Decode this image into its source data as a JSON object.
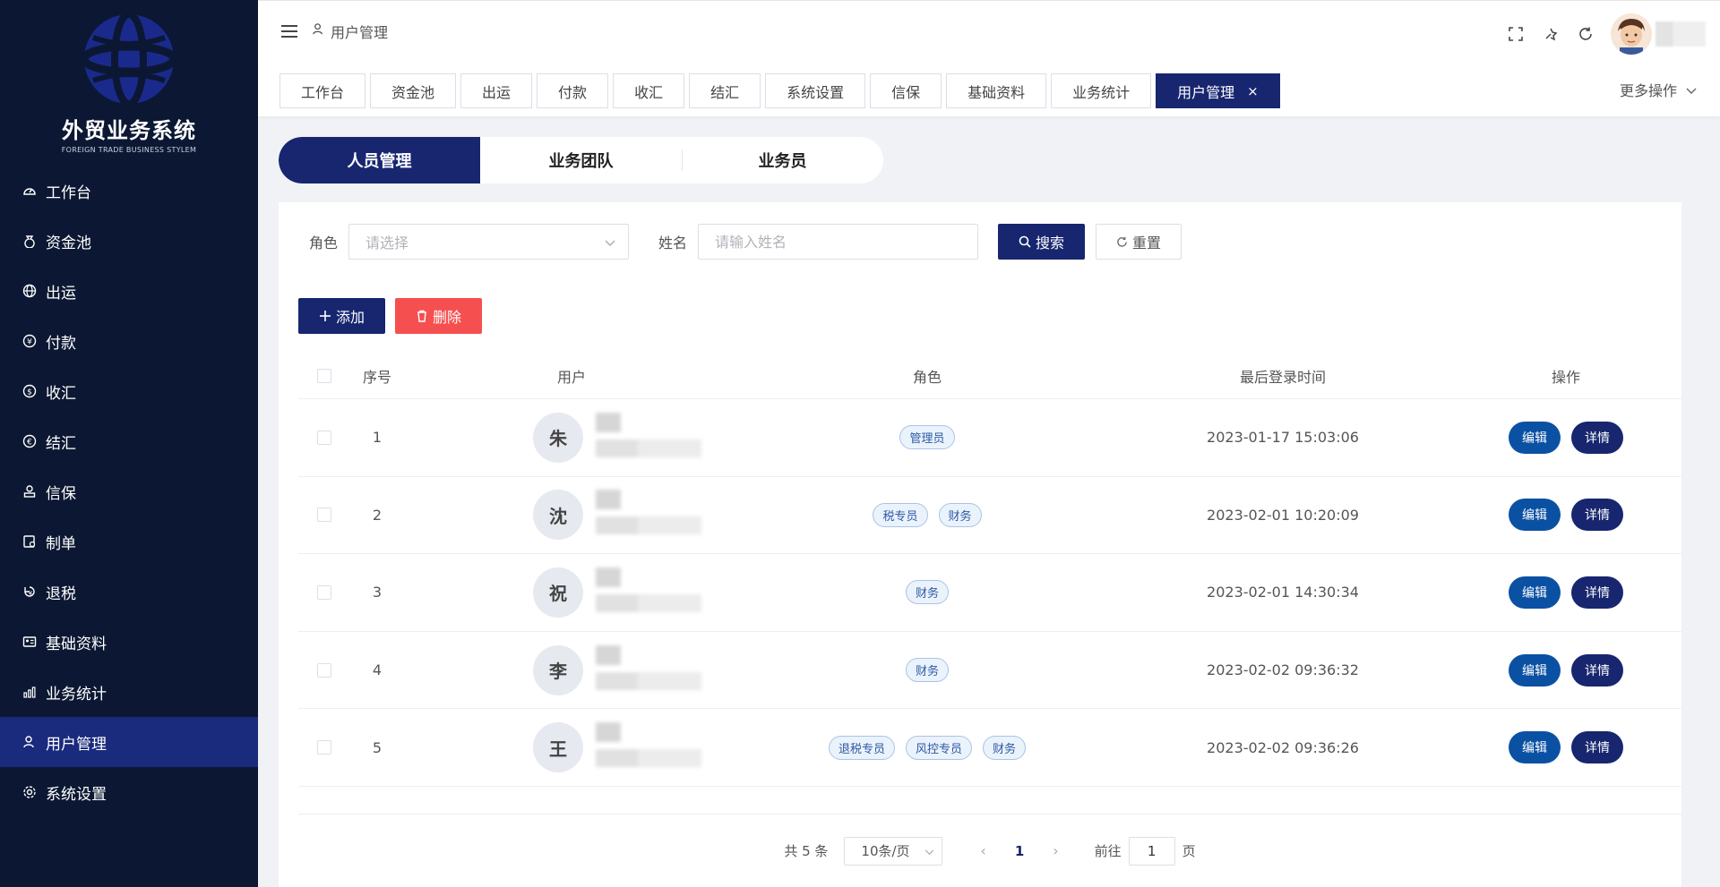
{
  "brand": {
    "title": "外贸业务系统",
    "subtitle": "FOREIGN TRADE BUSINESS STYLEM"
  },
  "sidebar": {
    "items": [
      {
        "label": "工作台",
        "icon": "dashboard-icon",
        "active": false
      },
      {
        "label": "资金池",
        "icon": "money-bag-icon",
        "active": false
      },
      {
        "label": "出运",
        "icon": "globe-icon",
        "active": false
      },
      {
        "label": "付款",
        "icon": "yen-coin-icon",
        "active": false
      },
      {
        "label": "收汇",
        "icon": "exchange-coin-icon",
        "active": false
      },
      {
        "label": "结汇",
        "icon": "settle-coin-icon",
        "active": false
      },
      {
        "label": "信保",
        "icon": "insurance-icon",
        "active": false
      },
      {
        "label": "制单",
        "icon": "document-icon",
        "active": false
      },
      {
        "label": "退税",
        "icon": "tax-refund-icon",
        "active": false
      },
      {
        "label": "基础资料",
        "icon": "id-card-icon",
        "active": false
      },
      {
        "label": "业务统计",
        "icon": "bar-chart-icon",
        "active": false
      },
      {
        "label": "用户管理",
        "icon": "user-icon",
        "active": true
      },
      {
        "label": "系统设置",
        "icon": "gear-icon",
        "active": false
      }
    ]
  },
  "header": {
    "breadcrumb": "用户管理",
    "icons": [
      "fullscreen-icon",
      "theme-icon",
      "refresh-icon"
    ]
  },
  "tabs": {
    "items": [
      {
        "label": "工作台"
      },
      {
        "label": "资金池"
      },
      {
        "label": "出运"
      },
      {
        "label": "付款"
      },
      {
        "label": "收汇"
      },
      {
        "label": "结汇"
      },
      {
        "label": "系统设置"
      },
      {
        "label": "信保"
      },
      {
        "label": "基础资料"
      },
      {
        "label": "业务统计"
      },
      {
        "label": "用户管理",
        "active": true,
        "close": "×"
      }
    ],
    "more": "更多操作"
  },
  "segment": {
    "items": [
      "人员管理",
      "业务团队",
      "业务员"
    ],
    "active_index": 0
  },
  "filters": {
    "role_label": "角色",
    "role_placeholder": "请选择",
    "name_label": "姓名",
    "name_placeholder": "请输入姓名",
    "search": "搜索",
    "reset": "重置"
  },
  "actions": {
    "add": "添加",
    "delete": "删除"
  },
  "table": {
    "headers": {
      "index": "序号",
      "user": "用户",
      "role": "角色",
      "last_login": "最后登录时间",
      "ops": "操作"
    },
    "rows": [
      {
        "index": "1",
        "avatar": "朱",
        "roles": [
          "管理员"
        ],
        "last_login": "2023-01-17 15:03:06"
      },
      {
        "index": "2",
        "avatar": "沈",
        "roles": [
          "税专员",
          "财务"
        ],
        "last_login": "2023-02-01 10:20:09"
      },
      {
        "index": "3",
        "avatar": "祝",
        "roles": [
          "财务"
        ],
        "last_login": "2023-02-01 14:30:34"
      },
      {
        "index": "4",
        "avatar": "李",
        "roles": [
          "财务"
        ],
        "last_login": "2023-02-02 09:36:32"
      },
      {
        "index": "5",
        "avatar": "王",
        "roles": [
          "退税专员",
          "风控专员",
          "财务"
        ],
        "last_login": "2023-02-02 09:36:26"
      }
    ],
    "edit_label": "编辑",
    "detail_label": "详情"
  },
  "pagination": {
    "total": "共 5 条",
    "page_size": "10条/页",
    "current": "1",
    "goto_prefix": "前往",
    "goto_value": "1",
    "goto_suffix": "页"
  },
  "colors": {
    "sidebar_bg": "#0c1833",
    "primary": "#17266f",
    "edit": "#0b51a3",
    "danger": "#f5504f"
  }
}
